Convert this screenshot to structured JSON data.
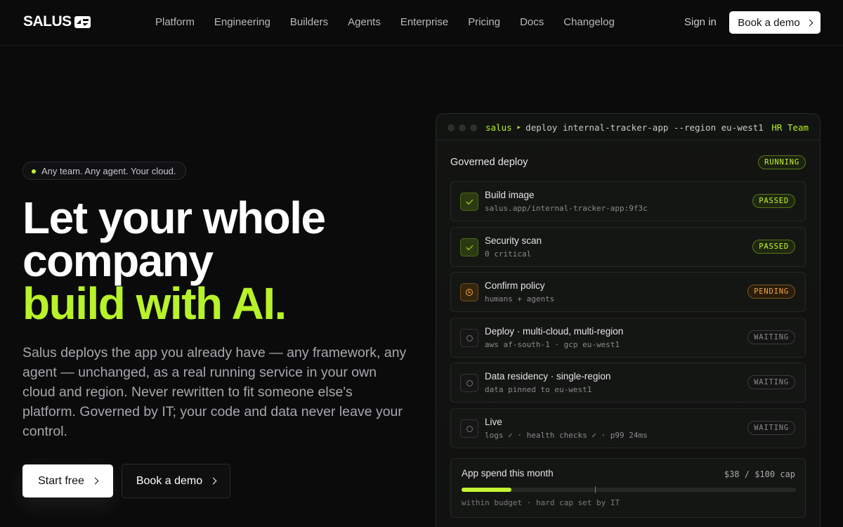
{
  "brand": {
    "name": "SALUS",
    "accent": "#b8f229"
  },
  "nav": {
    "links": [
      "Platform",
      "Engineering",
      "Builders",
      "Agents",
      "Enterprise",
      "Pricing",
      "Docs",
      "Changelog"
    ],
    "sign_in": "Sign in",
    "demo_label": "Book a demo"
  },
  "hero": {
    "pill": "Any team. Any agent. Your cloud.",
    "headline_line1": "Let your whole",
    "headline_line2": "company",
    "headline_accent": "build with AI.",
    "subtext": "Salus deploys the app you already have — any framework, any agent — unchanged, as a real running service in your own cloud and region. Never rewritten to fit someone else's platform. Governed by IT; your code and data never leave your control.",
    "start_label": "Start free",
    "demo_label": "Book a demo"
  },
  "panel": {
    "cmd_prefix": "salus",
    "cmd_arrow": "‣",
    "command": "deploy internal-tracker-app --region eu-west1",
    "team": "HR Team",
    "title": "Governed deploy",
    "status": "RUNNING",
    "steps": [
      {
        "name": "Build image",
        "detail": "salus.app/internal-tracker-app:9f3c",
        "status": "PASSED",
        "icon": "check-icon"
      },
      {
        "name": "Security scan",
        "detail": "0 critical",
        "status": "PASSED",
        "icon": "check-icon"
      },
      {
        "name": "Confirm policy",
        "detail": "humans + agents",
        "status": "PENDING",
        "icon": "clock-icon"
      },
      {
        "name": "Deploy · multi-cloud, multi-region",
        "detail": "aws af-south-1 · gcp eu-west1",
        "status": "WAITING",
        "icon": "circle-icon"
      },
      {
        "name": "Data residency · single-region",
        "detail": "data pinned to eu-west1",
        "status": "WAITING",
        "icon": "circle-icon"
      },
      {
        "name": "Live",
        "detail": "logs ✓ · health checks ✓ · p99 24ms",
        "status": "WAITING",
        "icon": "circle-icon"
      }
    ],
    "spend": {
      "title": "App spend this month",
      "amount": "$38 / $100 cap",
      "fill_fraction": 0.15,
      "mark_fraction": 0.4,
      "note": "within budget · hard cap set by IT"
    }
  }
}
